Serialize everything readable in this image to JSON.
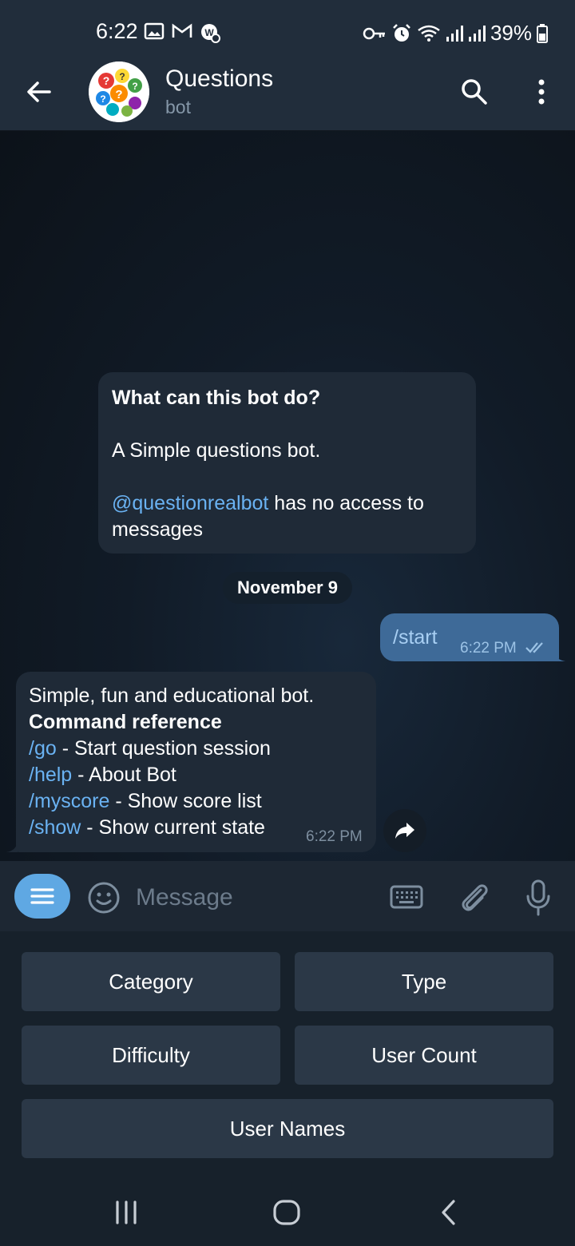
{
  "status_bar": {
    "time": "6:22",
    "battery_percent": "39%",
    "left_icons": [
      "gallery-icon",
      "gmail-icon",
      "app-notification-icon"
    ],
    "right_icons": [
      "vpn-key-icon",
      "alarm-icon",
      "wifi-icon",
      "signal-icon",
      "signal-icon",
      "battery-icon"
    ]
  },
  "header": {
    "title": "Questions",
    "subtitle": "bot"
  },
  "info_card": {
    "heading": "What can this bot do?",
    "description": "A Simple questions bot.",
    "mention": "@questionrealbot",
    "access_text_1": " has no access to",
    "access_text_2": "messages"
  },
  "date_separator": "November 9",
  "outgoing_message": {
    "text": "/start",
    "time": "6:22 PM",
    "status": "read"
  },
  "incoming_message": {
    "line1": "Simple, fun and educational bot.",
    "line2": "Command reference",
    "commands": [
      {
        "cmd": "/go",
        "desc": " - Start question session"
      },
      {
        "cmd": "/help",
        "desc": " - About Bot"
      },
      {
        "cmd": "/myscore",
        "desc": " - Show score list"
      },
      {
        "cmd": "/show",
        "desc": " - Show current state"
      }
    ],
    "time": "6:22 PM"
  },
  "input_bar": {
    "placeholder": "Message"
  },
  "bot_keyboard": {
    "buttons": [
      "Category",
      "Type",
      "Difficulty",
      "User Count",
      "User Names"
    ]
  },
  "colors": {
    "accent": "#6ab2f2",
    "header_bg": "#212d3b",
    "bubble_in": "#1f2a37",
    "bubble_out": "#3e6a98"
  }
}
